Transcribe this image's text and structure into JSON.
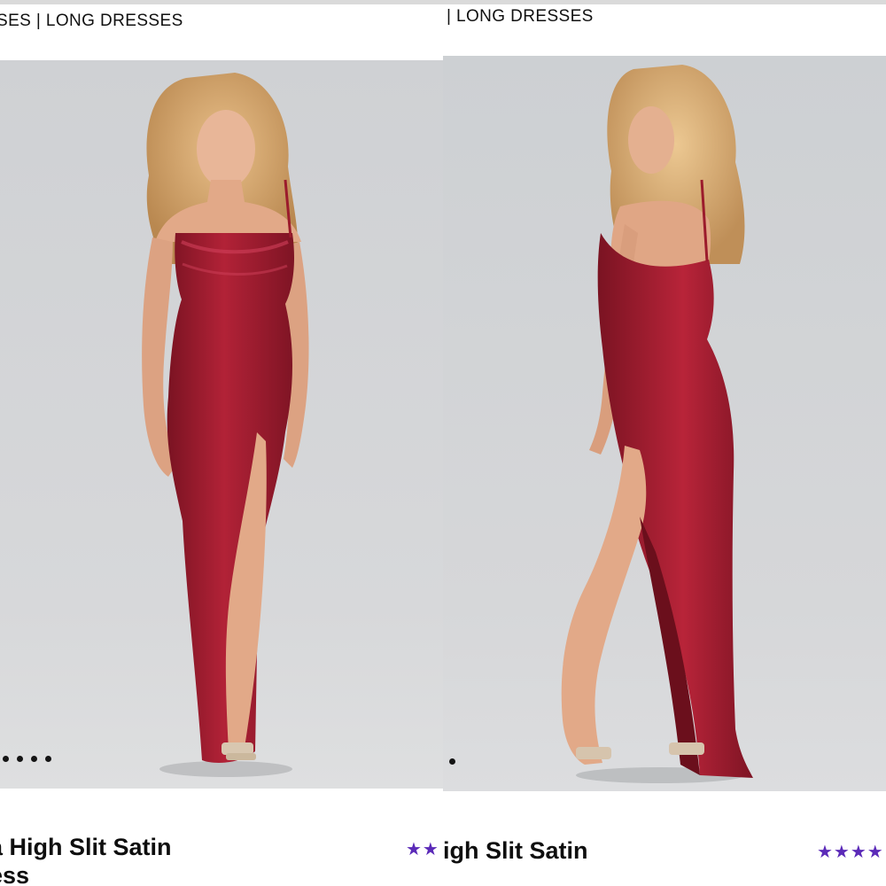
{
  "left_panel": {
    "breadcrumb": "SES | LONG DRESSES",
    "product_title_line1": "a High Slit Satin",
    "product_title_line2": "ess",
    "rating_stars": "★★",
    "carousel_dots": 4,
    "image_description": "model-front-view-red-satin-gown"
  },
  "right_panel": {
    "breadcrumb": "| LONG DRESSES",
    "product_title_line1": "igh Slit Satin",
    "rating_stars": "★★★★",
    "carousel_dots": 1,
    "image_description": "model-back-view-red-satin-gown"
  },
  "colors": {
    "dress": "#9b1b2c",
    "backdrop": "#cfd1d4",
    "star": "#5b2ab8"
  }
}
